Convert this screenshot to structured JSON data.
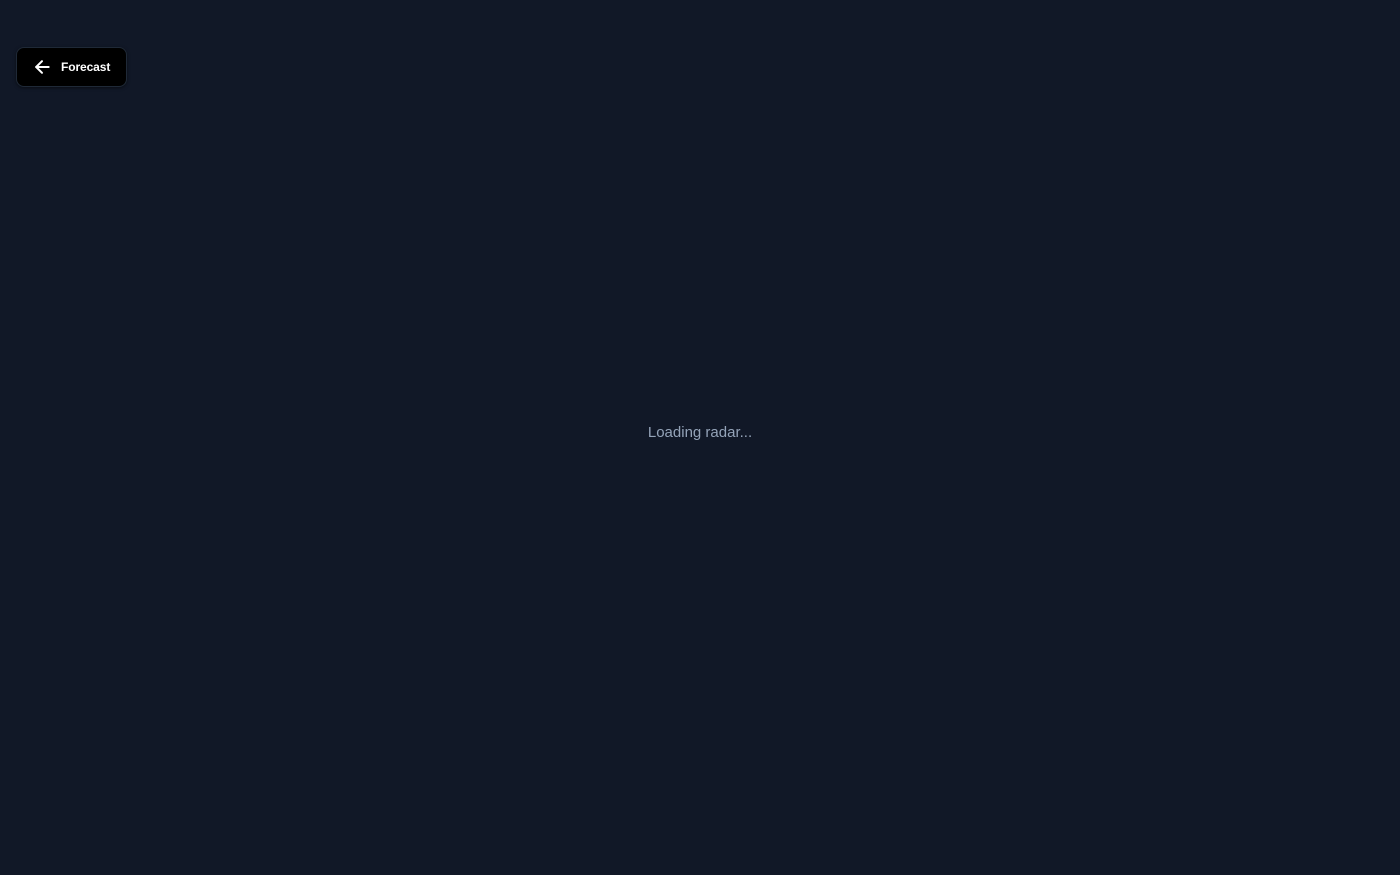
{
  "back_button": {
    "label": "Forecast",
    "icon": "arrow-left-icon"
  },
  "status": {
    "loading_text": "Loading radar..."
  },
  "colors": {
    "background": "#111827",
    "button_bg": "#000000",
    "button_text": "#ffffff",
    "status_text": "#94a3b8"
  }
}
